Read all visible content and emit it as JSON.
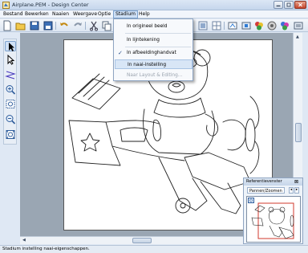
{
  "window": {
    "title": "Airplane.PEM - Design Center"
  },
  "menubar": {
    "items": [
      "Bestand",
      "Bewerken",
      "Naaien",
      "Weergave",
      "Optie",
      "Stadium",
      "Help"
    ]
  },
  "stadium_menu": {
    "items": [
      {
        "label": "In origineel beeld",
        "checked": false,
        "enabled": true
      },
      {
        "label": "In lijntekening",
        "checked": false,
        "enabled": true
      },
      {
        "label": "In afbeeldinghandvat",
        "checked": true,
        "enabled": true
      },
      {
        "label": "In naai-instelling",
        "checked": false,
        "enabled": true,
        "highlighted": true
      },
      {
        "label": "Naar Layout & Editing...",
        "checked": false,
        "enabled": false
      }
    ],
    "check_glyph": "✓"
  },
  "reference_panel": {
    "title": "Referentievenster",
    "tab_label": "Pannen/Zoomen",
    "tab_nav_left": "◂",
    "tab_nav_right": "▸",
    "close_glyph": "⊠"
  },
  "statusbar": {
    "text": "Stadium instelling naai-eigenschappen."
  },
  "colors": {
    "accent": "#7da2ce",
    "highlight": "#d8e6f6",
    "close_button": "#c4442c",
    "canvas_background": "#9aa6b3"
  },
  "toolbar_icons": [
    "new-file-icon",
    "open-folder-icon",
    "save-icon",
    "save-as-icon",
    "undo-icon",
    "redo-icon",
    "cut-icon",
    "copy-icon",
    "zoom-in-icon",
    "grid-icon",
    "tool-icon",
    "tool-icon",
    "palette-icon",
    "palette-icon",
    "palette-icon",
    "palette-icon",
    "sewing-icon"
  ],
  "left_tools": [
    "select-arrow-icon",
    "point-edit-icon",
    "line-draw-icon",
    "zoom-in-icon",
    "zoom-window-icon",
    "zoom-out-icon",
    "fit-page-icon"
  ]
}
